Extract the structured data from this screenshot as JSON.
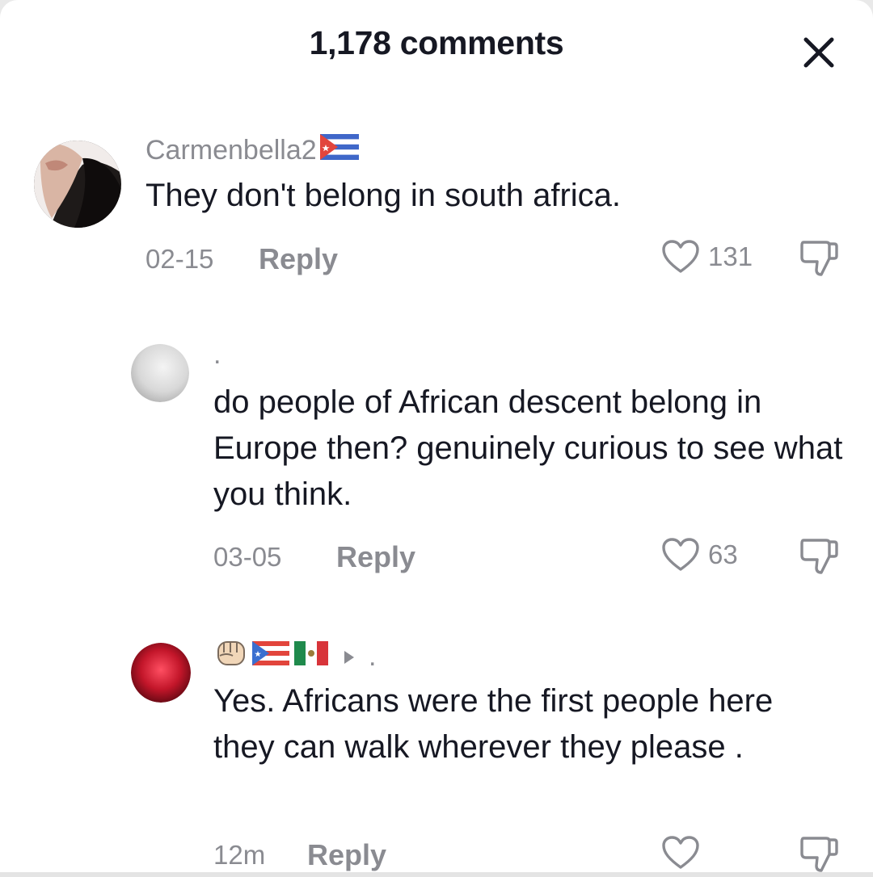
{
  "header": {
    "title": "1,178 comments"
  },
  "comments": [
    {
      "username": "Carmenbella2",
      "username_flag": "cuba-flag-icon",
      "text": "They don't belong in south africa.",
      "date": "02-15",
      "reply_label": "Reply",
      "likes": "131"
    },
    {
      "username": ".",
      "text": "do people of African descent belong in Europe then? genuinely curious to see what you think.",
      "date": "03-05",
      "reply_label": "Reply",
      "likes": "63"
    },
    {
      "username": ".",
      "username_icons": [
        "raised-fist-icon",
        "puerto-rico-flag-icon",
        "mexico-flag-icon",
        "reply-arrow-icon"
      ],
      "text": "Yes. Africans were the first people here they can walk wherever they please .",
      "date": "12m",
      "reply_label": "Reply",
      "likes": ""
    }
  ],
  "colors": {
    "primary_text": "#161823",
    "secondary_text": "#8a8b91",
    "background": "#ffffff"
  }
}
